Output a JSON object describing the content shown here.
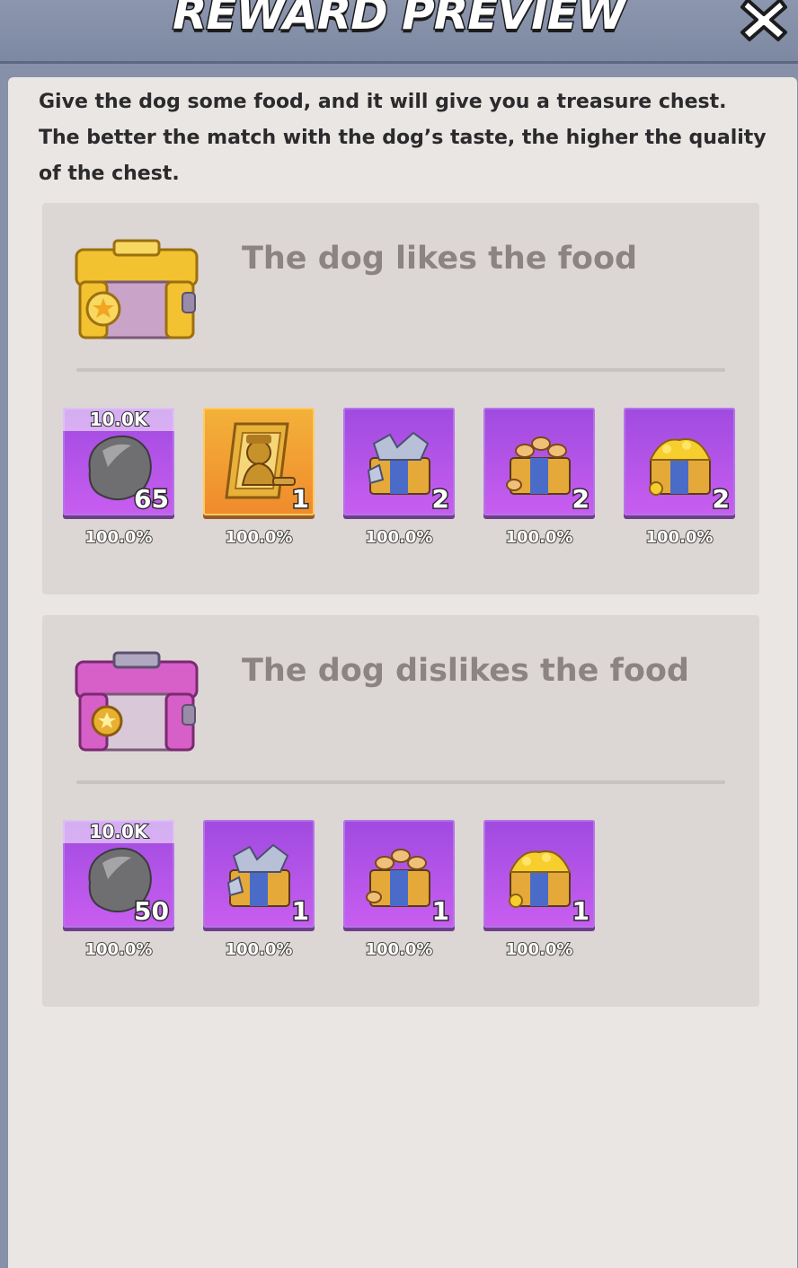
{
  "header": {
    "title": "REWARD PREVIEW",
    "close_icon": "close-icon"
  },
  "description": "Give the dog some food, and it will give you a treasure chest. The better the match with the dog’s taste, the higher the quality of the chest.",
  "sections": [
    {
      "title": "The dog likes the food",
      "chest_icon": "gold-chest-icon",
      "items": [
        {
          "icon": "rock-icon",
          "amount": "10.0K",
          "count": "65",
          "chance": "100.0%",
          "tile": "purple"
        },
        {
          "icon": "hero-card-icon",
          "amount": "",
          "count": "1",
          "chance": "100.0%",
          "tile": "gold"
        },
        {
          "icon": "steel-crate-icon",
          "amount": "",
          "count": "2",
          "chance": "100.0%",
          "tile": "purple"
        },
        {
          "icon": "wood-crate-icon",
          "amount": "",
          "count": "2",
          "chance": "100.0%",
          "tile": "purple"
        },
        {
          "icon": "gold-crate-icon",
          "amount": "",
          "count": "2",
          "chance": "100.0%",
          "tile": "purple"
        }
      ]
    },
    {
      "title": "The dog dislikes the food",
      "chest_icon": "pink-chest-icon",
      "items": [
        {
          "icon": "rock-icon",
          "amount": "10.0K",
          "count": "50",
          "chance": "100.0%",
          "tile": "purple"
        },
        {
          "icon": "steel-crate-icon",
          "amount": "",
          "count": "1",
          "chance": "100.0%",
          "tile": "purple"
        },
        {
          "icon": "wood-crate-icon",
          "amount": "",
          "count": "1",
          "chance": "100.0%",
          "tile": "purple"
        },
        {
          "icon": "gold-crate-icon",
          "amount": "",
          "count": "1",
          "chance": "100.0%",
          "tile": "purple"
        }
      ]
    }
  ],
  "colors": {
    "header_bg": "#7d88a2",
    "panel_bg": "#eae6e3",
    "card_bg": "#dcd7d4",
    "tile_purple": "#b454ea",
    "tile_gold": "#f39e32",
    "card_title": "#8b8482"
  }
}
